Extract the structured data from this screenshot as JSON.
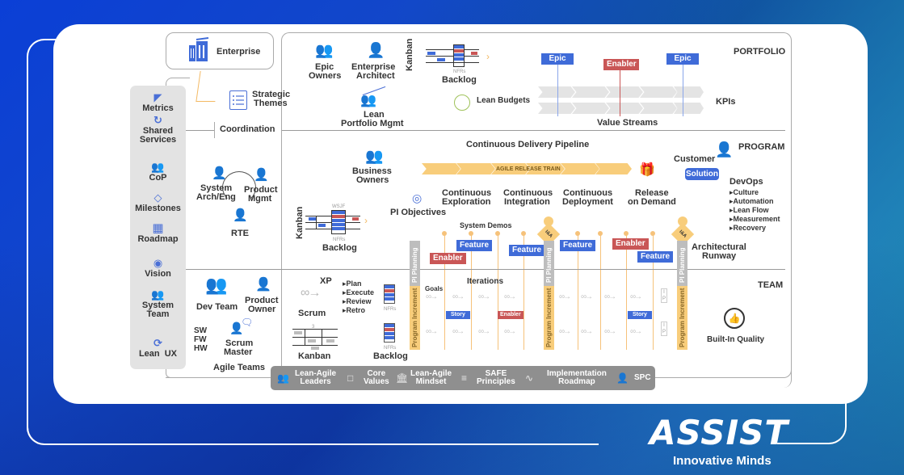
{
  "colors": {
    "blue_tag": "#3f6bd8",
    "red_tag": "#c95656",
    "orange": "#f8cd7b",
    "gray_bar": "#8f8f8f",
    "icon_blue": "#4a6fd6",
    "bg_blue": "#0b3fd6",
    "bg_teal": "#2f8ed6"
  },
  "portfolio": {
    "level_label": "PORTFOLIO",
    "enterprise": "Enterprise",
    "strategic_themes": [
      "Strategic",
      "Themes"
    ],
    "epic_owners": [
      "Epic",
      "Owners"
    ],
    "enterprise_architect": [
      "Enterprise",
      "Architect"
    ],
    "lean_portfolio_mgmt": [
      "Lean",
      "Portfolio Mgmt"
    ],
    "kanban_label": "Kanban",
    "nfrs": "NFRs",
    "backlog": "Backlog",
    "lean_budgets": "Lean Budgets",
    "value_streams": "Value Streams",
    "kpis": "KPIs",
    "tags": [
      {
        "label": "Epic",
        "type": "epic"
      },
      {
        "label": "Enabler",
        "type": "enabler"
      },
      {
        "label": "Epic",
        "type": "epic"
      }
    ],
    "coordination": "Coordination"
  },
  "sidebar": {
    "items": [
      {
        "label": "Metrics",
        "icon": "gauge-icon"
      },
      {
        "label": "Shared Services",
        "icon": "shared-services-icon"
      },
      {
        "label": "CoP",
        "icon": "community-icon"
      },
      {
        "label": "Milestones",
        "icon": "diamond-icon"
      },
      {
        "label": "Roadmap",
        "icon": "map-icon"
      },
      {
        "label": "Vision",
        "icon": "eye-icon"
      },
      {
        "label": "System Team",
        "icon": "system-team-icon"
      },
      {
        "label": "Lean  UX",
        "icon": "cycle-icon"
      }
    ],
    "shared": [
      "Shared",
      "Services"
    ],
    "system_team": [
      "System",
      "Team"
    ]
  },
  "program": {
    "level_label": "PROGRAM",
    "cdp_title": "Continuous Delivery Pipeline",
    "art_label": "AGILE RELEASE TRAIN",
    "business_owners": [
      "Business",
      "Owners"
    ],
    "system_arch": [
      "System",
      "Arch/Eng"
    ],
    "product_mgmt": [
      "Product",
      "Mgmt"
    ],
    "rte": "RTE",
    "wsjf": "WSJF",
    "kanban_label": "Kanban",
    "nfrs": "NFRs",
    "backlog": "Backlog",
    "pi_objectives": "PI Objectives",
    "stages": [
      [
        "Continuous",
        "Exploration"
      ],
      [
        "Continuous",
        "Integration"
      ],
      [
        "Continuous",
        "Deployment"
      ],
      [
        "Release",
        "on Demand"
      ]
    ],
    "customer": "Customer",
    "solution": "Solution",
    "devops": {
      "title": "DevOps",
      "items": [
        "Culture",
        "Automation",
        "Lean Flow",
        "Measurement",
        "Recovery"
      ]
    },
    "system_demos": "System Demos",
    "ia_label": "I&A",
    "architectural_runway": [
      "Architectural",
      "Runway"
    ],
    "tags": [
      {
        "label": "Enabler",
        "type": "enabler"
      },
      {
        "label": "Feature",
        "type": "feature"
      },
      {
        "label": "Feature",
        "type": "feature"
      },
      {
        "label": "Feature",
        "type": "feature"
      },
      {
        "label": "Enabler",
        "type": "enabler"
      },
      {
        "label": "Feature",
        "type": "feature"
      }
    ]
  },
  "team": {
    "level_label": "TEAM",
    "dev_team": "Dev Team",
    "product_owner": [
      "Product",
      "Owner"
    ],
    "scrum_master": [
      "Scrum",
      "Master"
    ],
    "sw_fw_hw": [
      "SW",
      "FW",
      "HW"
    ],
    "agile_teams": "Agile Teams",
    "xp": "XP",
    "scrum": "Scrum",
    "ceremonies": [
      "Plan",
      "Execute",
      "Review",
      "Retro"
    ],
    "nfrs": "NFRs",
    "kanban": "Kanban",
    "kanban_wip": "3",
    "backlog": "Backlog",
    "goals": "Goals",
    "iterations": "Iterations",
    "ip_label": [
      "I",
      "P"
    ],
    "pi_planning": "PI Planning",
    "program_increment": "Program Increment",
    "tags": [
      {
        "label": "Story",
        "type": "story"
      },
      {
        "label": "Enabler",
        "type": "enabler"
      },
      {
        "label": "Story",
        "type": "story"
      }
    ],
    "built_in_quality": "Built-In Quality"
  },
  "foundation": [
    {
      "label": [
        "Lean-Agile",
        "Leaders"
      ],
      "icon": "leaders-icon"
    },
    {
      "label": [
        "Core",
        "Values"
      ],
      "icon": "core-values-icon"
    },
    {
      "label": [
        "Lean-Agile",
        "Mindset"
      ],
      "icon": "mindset-icon"
    },
    {
      "label": [
        "SAFE",
        "Principles"
      ],
      "icon": "principles-icon"
    },
    {
      "label": [
        "Implementation",
        "Roadmap"
      ],
      "icon": "roadmap-icon"
    },
    {
      "label": [
        "SPC"
      ],
      "icon": "spc-icon"
    }
  ],
  "brand": {
    "logo": "ASSIST",
    "tagline": "Innovative Minds"
  }
}
